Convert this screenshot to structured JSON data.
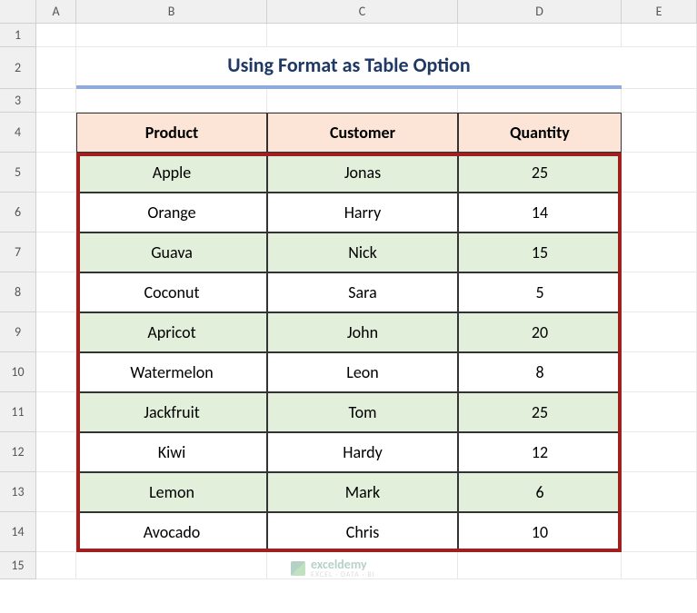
{
  "columns": [
    "A",
    "B",
    "C",
    "D",
    "E"
  ],
  "rows": [
    "1",
    "2",
    "3",
    "4",
    "5",
    "6",
    "7",
    "8",
    "9",
    "10",
    "11",
    "12",
    "13",
    "14",
    "15"
  ],
  "title": "Using Format as Table Option",
  "headers": {
    "product": "Product",
    "customer": "Customer",
    "quantity": "Quantity"
  },
  "data": [
    {
      "product": "Apple",
      "customer": "Jonas",
      "quantity": "25"
    },
    {
      "product": "Orange",
      "customer": "Harry",
      "quantity": "14"
    },
    {
      "product": "Guava",
      "customer": "Nick",
      "quantity": "15"
    },
    {
      "product": "Coconut",
      "customer": "Sara",
      "quantity": "5"
    },
    {
      "product": "Apricot",
      "customer": "John",
      "quantity": "20"
    },
    {
      "product": "Watermelon",
      "customer": "Leon",
      "quantity": "8"
    },
    {
      "product": "Jackfruit",
      "customer": "Tom",
      "quantity": "25"
    },
    {
      "product": "Kiwi",
      "customer": "Hardy",
      "quantity": "12"
    },
    {
      "product": "Lemon",
      "customer": "Mark",
      "quantity": "6"
    },
    {
      "product": "Avocado",
      "customer": "Chris",
      "quantity": "10"
    }
  ],
  "watermark": {
    "main": "exceldemy",
    "sub": "EXCEL · DATA · BI"
  }
}
